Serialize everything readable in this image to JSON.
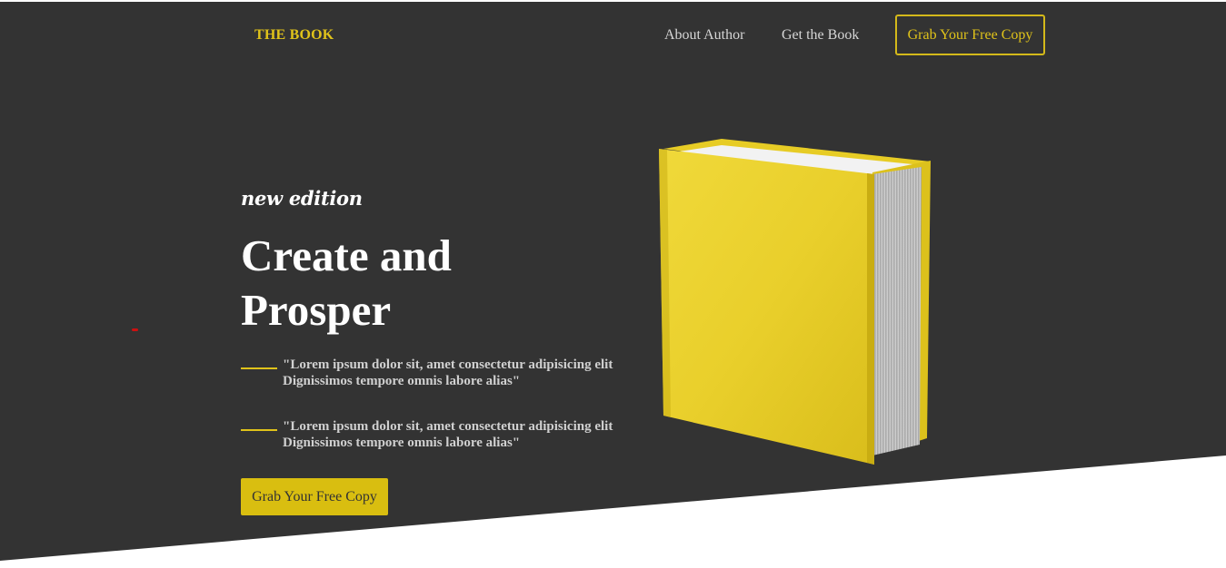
{
  "nav": {
    "brand": "THE BOOK",
    "links": [
      {
        "label": "About Author"
      },
      {
        "label": "Get the Book"
      }
    ],
    "cta_label": "Grab Your Free Copy"
  },
  "hero": {
    "kicker": "new edition",
    "title_line1": "Create and",
    "title_line2": "Prosper",
    "quotes": [
      {
        "text": "\"Lorem ipsum dolor sit, amet consectetur adipisicing elit Dignissimos tempore omnis labore alias\""
      },
      {
        "text": "\"Lorem ipsum dolor sit, amet consectetur adipisicing elit Dignissimos tempore omnis labore alias\""
      }
    ],
    "cta_label": "Grab Your Free Copy"
  },
  "colors": {
    "background_dark": "#333333",
    "accent_yellow": "#e0c31a",
    "cta_yellow": "#d9be10",
    "text_light": "#d0d0d0",
    "page_white": "#ffffff"
  },
  "icons": {
    "book_image": "yellow-hardcover-book"
  }
}
